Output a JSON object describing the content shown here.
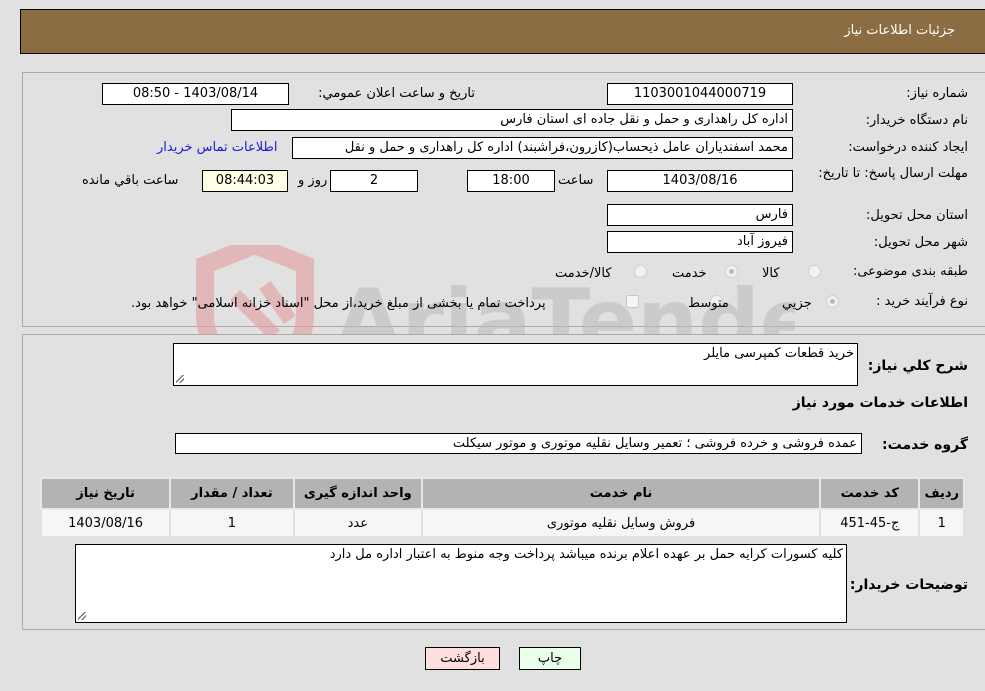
{
  "header": {
    "title": "جزئیات اطلاعات نیاز"
  },
  "form": {
    "need_number": {
      "label": "شماره نیاز:",
      "value": "1103001044000719"
    },
    "announce_datetime": {
      "label": "تاریخ و ساعت اعلان عمومي:",
      "value": "1403/08/14 - 08:50"
    },
    "buyer_org": {
      "label": "نام دستگاه خریدار:",
      "value": "اداره کل راهداری و حمل و نقل جاده ای استان فارس"
    },
    "requester": {
      "label": "ایجاد کننده درخواست:",
      "value": "محمد اسفندیاران عامل ذیحساب(کازرون،فراشبند) اداره کل راهداری و حمل و نقل"
    },
    "contact_link": "اطلاعات تماس خریدار",
    "deadline": {
      "label": "مهلت ارسال پاسخ: تا تاریخ:",
      "date": "1403/08/16",
      "time_label": "ساعت",
      "time": "18:00",
      "days": "2",
      "days_label": "روز و",
      "remaining": "08:44:03",
      "remaining_label": "ساعت باقي مانده"
    },
    "delivery_province": {
      "label": "استان محل تحویل:",
      "value": "فارس"
    },
    "delivery_city": {
      "label": "شهر محل تحویل:",
      "value": "فیروز آباد"
    },
    "category": {
      "label": "طبقه بندی موضوعی:",
      "options": [
        "کالا",
        "خدمت",
        "کالا/خدمت"
      ],
      "selected": "خدمت"
    },
    "purchase_type": {
      "label": "نوع فرآیند خرید :",
      "options": [
        "جزيي",
        "متوسط"
      ],
      "selected": "جزيي",
      "treasury_note": "پرداخت تمام یا بخشی از مبلغ خرید،از محل \"اسناد خزانه اسلامی\" خواهد بود."
    }
  },
  "details": {
    "description_label": "شرح کلي نیاز:",
    "description": "خرید قطعات کمپرسی مایلر",
    "services_heading": "اطلاعات خدمات مورد نیاز",
    "service_group_label": "گروه خدمت:",
    "service_group": "عمده فروشی و خرده فروشی ؛ تعمیر وسایل نقلیه موتوری و موتور سیکلت",
    "table": {
      "headers": [
        "ردیف",
        "کد خدمت",
        "نام خدمت",
        "واحد اندازه گیری",
        "تعداد / مقدار",
        "تاریخ نیاز"
      ],
      "rows": [
        [
          "1",
          "ج-45-451",
          "فروش وسایل نقلیه موتوری",
          "عدد",
          "1",
          "1403/08/16"
        ]
      ]
    },
    "buyer_notes_label": "توضیحات خریدار:",
    "buyer_notes": "کلیه کسورات کرایه حمل بر عهده اعلام برنده میباشد پرداخت وجه منوط به اعتبار اداره مل دارد"
  },
  "buttons": {
    "print": "چاپ",
    "back": "بازگشت"
  },
  "watermark": {
    "text": "AriaTender.neT"
  }
}
